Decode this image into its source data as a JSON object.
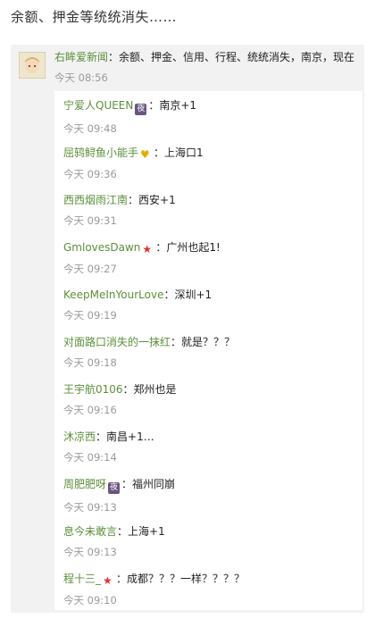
{
  "page_title": "余额、押金等统统消失……",
  "post": {
    "author": "右眸爱新闻",
    "text": "：余额、押金、信用、行程、统统消失，南京，现在",
    "time": "今天 08:56"
  },
  "replies": [
    {
      "author": "宁爱人QUEEN",
      "badge": "night",
      "badge_glyph": "夜",
      "text": "：南京+1",
      "time": "今天 09:48"
    },
    {
      "author": "屈鸫鲟鱼小能手",
      "badge": "heart",
      "badge_glyph": "♥",
      "text": "：上海口1",
      "time": "今天 09:36"
    },
    {
      "author": "西西烟雨江南",
      "badge": "",
      "badge_glyph": "",
      "text": "：西安+1",
      "time": "今天 09:31"
    },
    {
      "author": "GmlovesDawn",
      "badge": "star",
      "badge_glyph": "★",
      "text": "：广州也起1!",
      "time": "今天 09:27"
    },
    {
      "author": "KeepMeInYourLove",
      "badge": "",
      "badge_glyph": "",
      "text": "：深圳+1",
      "time": "今天 09:19"
    },
    {
      "author": "对面路口消失的一抹红",
      "badge": "",
      "badge_glyph": "",
      "text": "：就是？？？",
      "time": "今天 09:18"
    },
    {
      "author": "王宇航0106",
      "badge": "",
      "badge_glyph": "",
      "text": "：郑州也是",
      "time": "今天 09:16"
    },
    {
      "author": "沐凉西",
      "badge": "",
      "badge_glyph": "",
      "text": "：南昌+1…",
      "time": "今天 09:14"
    },
    {
      "author": "周肥肥呀",
      "badge": "night",
      "badge_glyph": "夜",
      "text": "：福州同崩",
      "time": "今天 09:13"
    },
    {
      "author": "息今未敢言",
      "badge": "",
      "badge_glyph": "",
      "text": "：上海+1",
      "time": "今天 09:13"
    },
    {
      "author": "程十三_",
      "badge": "star",
      "badge_glyph": "★",
      "text": "：成都？？？一样？？？？",
      "time": "今天 09:10"
    }
  ],
  "colors": {
    "author": "#5b8f3a",
    "time": "#9a9a9a",
    "card_bg": "#f2f2f2"
  }
}
